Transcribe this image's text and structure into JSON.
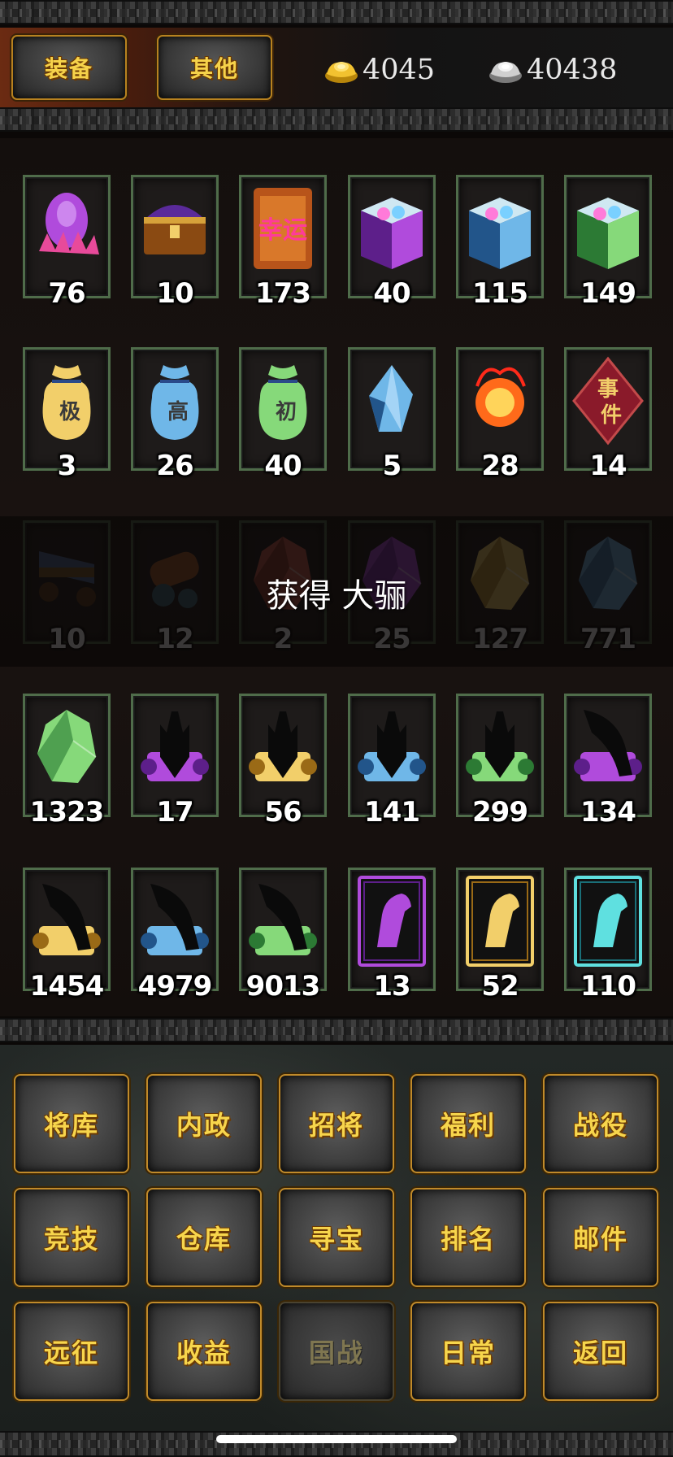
{
  "tabs": [
    {
      "label": "装备",
      "name": "tab-equipment"
    },
    {
      "label": "其他",
      "name": "tab-other"
    }
  ],
  "currency": {
    "gold": {
      "icon": "gold-ingot-icon",
      "value": "4045"
    },
    "silver": {
      "icon": "silver-ingot-icon",
      "value": "40438"
    }
  },
  "items": [
    {
      "icon": "purple-egg-icon",
      "count": "76"
    },
    {
      "icon": "treasure-chest-icon",
      "count": "10"
    },
    {
      "icon": "lucky-bag-icon",
      "count": "173"
    },
    {
      "icon": "purple-gem-box-icon",
      "count": "40"
    },
    {
      "icon": "blue-gem-box-icon",
      "count": "115"
    },
    {
      "icon": "green-gem-box-icon",
      "count": "149"
    },
    {
      "icon": "gold-pouch-icon",
      "count": "3"
    },
    {
      "icon": "blue-pouch-icon",
      "count": "26"
    },
    {
      "icon": "green-pouch-icon",
      "count": "40"
    },
    {
      "icon": "blue-crystal-icon",
      "count": "5"
    },
    {
      "icon": "fire-orb-icon",
      "count": "28"
    },
    {
      "icon": "event-token-icon",
      "count": "14"
    },
    {
      "icon": "siege-cart-icon",
      "count": "10"
    },
    {
      "icon": "cannon-icon",
      "count": "12"
    },
    {
      "icon": "red-ore-icon",
      "count": "2"
    },
    {
      "icon": "purple-ore-icon",
      "count": "25"
    },
    {
      "icon": "gold-ore-icon",
      "count": "127"
    },
    {
      "icon": "blue-ore-icon",
      "count": "771"
    },
    {
      "icon": "green-ore-icon",
      "count": "1323"
    },
    {
      "icon": "purple-helm-scroll-icon",
      "count": "17"
    },
    {
      "icon": "gold-helm-scroll-icon",
      "count": "56"
    },
    {
      "icon": "blue-helm-scroll-icon",
      "count": "141"
    },
    {
      "icon": "green-helm-scroll-icon",
      "count": "299"
    },
    {
      "icon": "purple-blade-scroll-icon",
      "count": "134"
    },
    {
      "icon": "gold-blade-scroll-icon",
      "count": "1454"
    },
    {
      "icon": "blue-blade-scroll-icon",
      "count": "4979"
    },
    {
      "icon": "green-blade-scroll-icon",
      "count": "9013"
    },
    {
      "icon": "purple-horse-card-icon",
      "count": "13"
    },
    {
      "icon": "gold-horse-card-icon",
      "count": "52"
    },
    {
      "icon": "cyan-horse-card-icon",
      "count": "110"
    }
  ],
  "notice": "获得 大骊",
  "menu": [
    {
      "label": "将库",
      "enabled": true
    },
    {
      "label": "内政",
      "enabled": true
    },
    {
      "label": "招将",
      "enabled": true
    },
    {
      "label": "福利",
      "enabled": true
    },
    {
      "label": "战役",
      "enabled": true
    },
    {
      "label": "竞技",
      "enabled": true
    },
    {
      "label": "仓库",
      "enabled": true
    },
    {
      "label": "寻宝",
      "enabled": true
    },
    {
      "label": "排名",
      "enabled": true
    },
    {
      "label": "邮件",
      "enabled": true
    },
    {
      "label": "远征",
      "enabled": true
    },
    {
      "label": "收益",
      "enabled": true
    },
    {
      "label": "国战",
      "enabled": false
    },
    {
      "label": "日常",
      "enabled": true
    },
    {
      "label": "返回",
      "enabled": true
    }
  ],
  "colors": {
    "button_text": "#f7d54c",
    "button_border": "#c08a2a",
    "item_frame": "#4f6c4a"
  }
}
